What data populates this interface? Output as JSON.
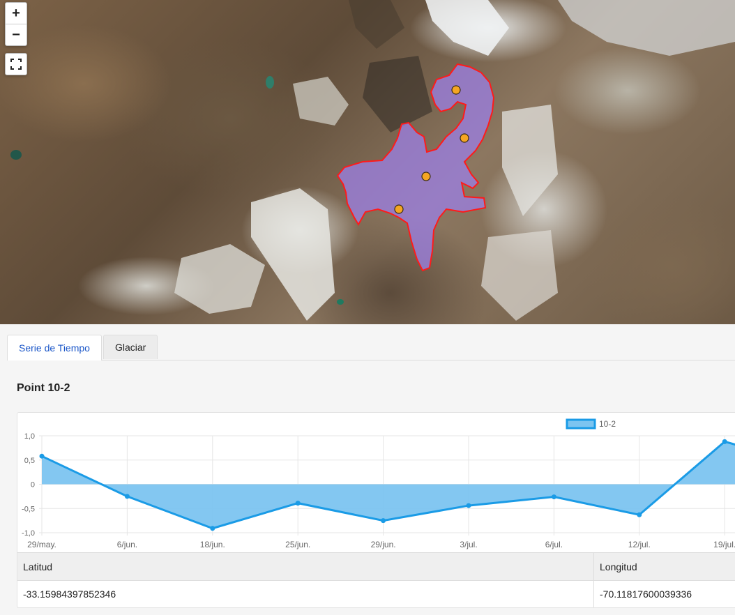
{
  "map": {
    "controls": {
      "zoom_in": "+",
      "zoom_out": "−",
      "fullscreen_icon": "fullscreen-icon"
    },
    "glacier_fill": "#9b7fe0",
    "glacier_outline": "#ff1a1a",
    "marker_color": "#f5a623",
    "markers": 4
  },
  "tabs": [
    {
      "label": "Serie de Tiempo",
      "active": true
    },
    {
      "label": "Glaciar",
      "active": false
    }
  ],
  "point": {
    "title": "Point 10-2"
  },
  "chart_data": {
    "type": "area",
    "title": "",
    "xlabel": "",
    "ylabel": "",
    "legend": {
      "position": "top",
      "label": "10-2"
    },
    "grid": true,
    "color": "#1a9be6",
    "fill": "#7cc4f0",
    "ylim": [
      -1.0,
      1.0
    ],
    "y_ticks": [
      "1,0",
      "0,5",
      "0",
      "-0,5",
      "-1,0"
    ],
    "categories": [
      "29/may.",
      "6/jun.",
      "18/jun.",
      "25/jun.",
      "29/jun.",
      "3/jul.",
      "6/jul.",
      "12/jul.",
      "19/jul."
    ],
    "series": [
      {
        "name": "10-2",
        "values": [
          0.58,
          -0.25,
          -0.91,
          -0.39,
          -0.75,
          -0.44,
          -0.26,
          -0.63,
          0.88
        ]
      }
    ],
    "extra_point_after_last": 0.72
  },
  "table": {
    "headers": [
      "Latitud",
      "Longitud"
    ],
    "rows": [
      [
        "-33.15984397852346",
        "-70.11817600039336"
      ]
    ]
  }
}
